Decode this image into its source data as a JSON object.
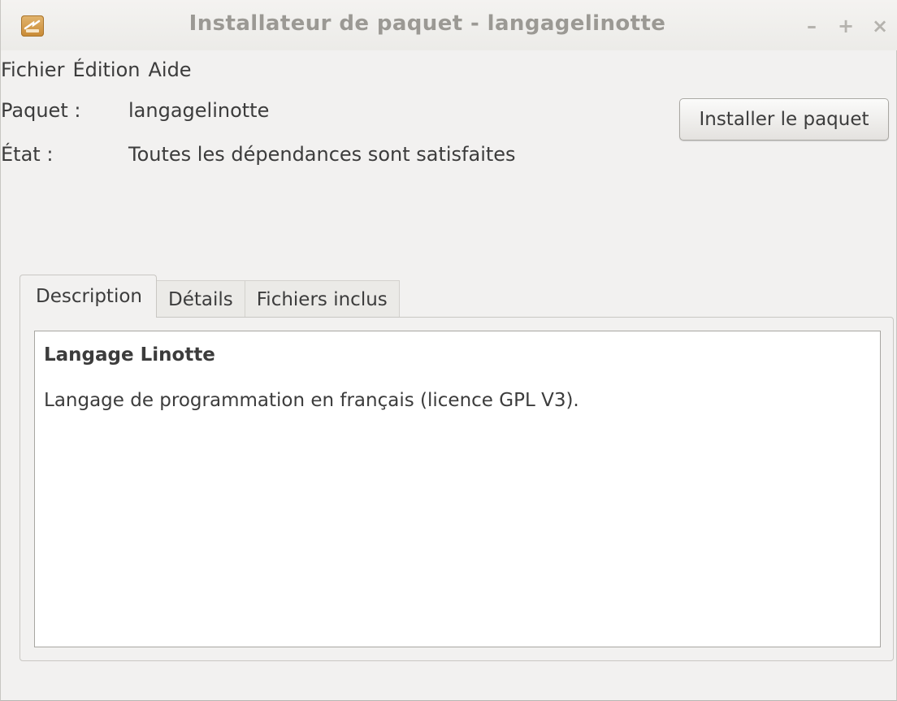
{
  "window": {
    "title": "Installateur de paquet - langagelinotte",
    "controls": {
      "minimize": "–",
      "maximize": "+",
      "close": "×"
    }
  },
  "menubar": {
    "items": [
      {
        "label": "Fichier"
      },
      {
        "label": "Édition"
      },
      {
        "label": "Aide"
      }
    ]
  },
  "info": {
    "package_label": "Paquet :",
    "package_value": "langagelinotte",
    "status_label": "État :",
    "status_value": "Toutes les dépendances sont satisfaites"
  },
  "install_button": {
    "label": "Installer le paquet"
  },
  "tabs": [
    {
      "label": "Description",
      "active": true
    },
    {
      "label": "Détails",
      "active": false
    },
    {
      "label": "Fichiers inclus",
      "active": false
    }
  ],
  "description": {
    "title": "Langage Linotte",
    "body": "Langage de programmation en français (licence GPL V3)."
  },
  "icons": {
    "app": "package-installer-icon",
    "minimize": "minimize-icon",
    "maximize": "maximize-icon",
    "close": "close-icon"
  },
  "colors": {
    "window_bg": "#f2f1f0",
    "title_text": "#9b9994",
    "text": "#3c3c3c",
    "app_icon": "#c98a34"
  }
}
